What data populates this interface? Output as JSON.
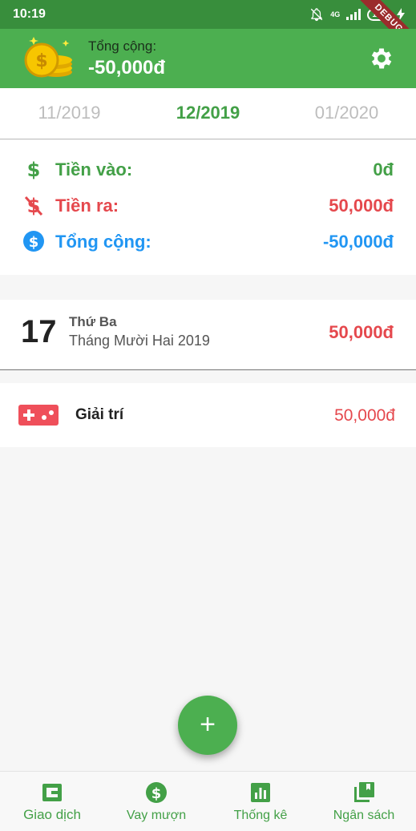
{
  "status_bar": {
    "time": "10:19",
    "network": "4G",
    "battery": "100",
    "debug_ribbon": "DEBUG"
  },
  "header": {
    "total_label": "Tổng cộng:",
    "total_value": "-50,000đ",
    "icons": {
      "logo": "coins-icon",
      "settings": "gear-icon"
    }
  },
  "month_tabs": [
    {
      "label": "11/2019",
      "active": false
    },
    {
      "label": "12/2019",
      "active": true
    },
    {
      "label": "01/2020",
      "active": false
    }
  ],
  "summary": {
    "income": {
      "label": "Tiền vào:",
      "value": "0đ",
      "icon": "dollar-icon",
      "color": "#43a047"
    },
    "expense": {
      "label": "Tiền ra:",
      "value": "50,000đ",
      "icon": "dollar-off-icon",
      "color": "#e5484d"
    },
    "total": {
      "label": "Tổng cộng:",
      "value": "-50,000đ",
      "icon": "dollar-circle-icon",
      "color": "#2196f3"
    }
  },
  "day_group": {
    "day": "17",
    "weekday": "Thứ Ba",
    "month_year": "Tháng Mười Hai 2019",
    "total": "50,000đ"
  },
  "transactions": [
    {
      "category": "Giải trí",
      "amount": "50,000đ",
      "icon": "gamepad-icon"
    }
  ],
  "fab": {
    "label": "+"
  },
  "bottom_nav": [
    {
      "label": "Giao dịch",
      "icon": "wallet-icon",
      "active": true
    },
    {
      "label": "Vay mượn",
      "icon": "dollar-circle-icon",
      "active": false
    },
    {
      "label": "Thống kê",
      "icon": "bar-chart-icon",
      "active": false
    },
    {
      "label": "Ngân sách",
      "icon": "library-books-icon",
      "active": false
    }
  ],
  "colors": {
    "primary": "#4caf50",
    "primary_dark": "#388e3c",
    "expense": "#e5484d",
    "total": "#2196f3"
  }
}
